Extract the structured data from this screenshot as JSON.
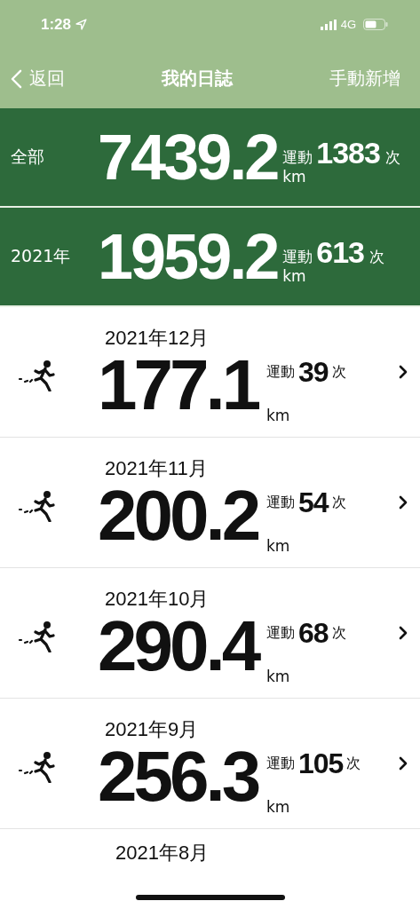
{
  "status_bar": {
    "time": "1:28",
    "network": "4G"
  },
  "nav": {
    "back": "返回",
    "title": "我的日誌",
    "action": "手動新增"
  },
  "summaries": [
    {
      "label": "全部",
      "distance": "7439.2",
      "unit": "km",
      "activity_label": "運動",
      "count": "1383",
      "count_unit": "次"
    },
    {
      "label": "2021年",
      "distance": "1959.2",
      "unit": "km",
      "activity_label": "運動",
      "count": "613",
      "count_unit": "次"
    }
  ],
  "months": [
    {
      "month": "2021年12月",
      "distance": "177.1",
      "unit": "km",
      "activity_label": "運動",
      "count": "39",
      "count_unit": "次"
    },
    {
      "month": "2021年11月",
      "distance": "200.2",
      "unit": "km",
      "activity_label": "運動",
      "count": "54",
      "count_unit": "次"
    },
    {
      "month": "2021年10月",
      "distance": "290.4",
      "unit": "km",
      "activity_label": "運動",
      "count": "68",
      "count_unit": "次"
    },
    {
      "month": "2021年9月",
      "distance": "256.3",
      "unit": "km",
      "activity_label": "運動",
      "count": "105",
      "count_unit": "次"
    }
  ],
  "partial_month": {
    "month": "2021年8月"
  }
}
